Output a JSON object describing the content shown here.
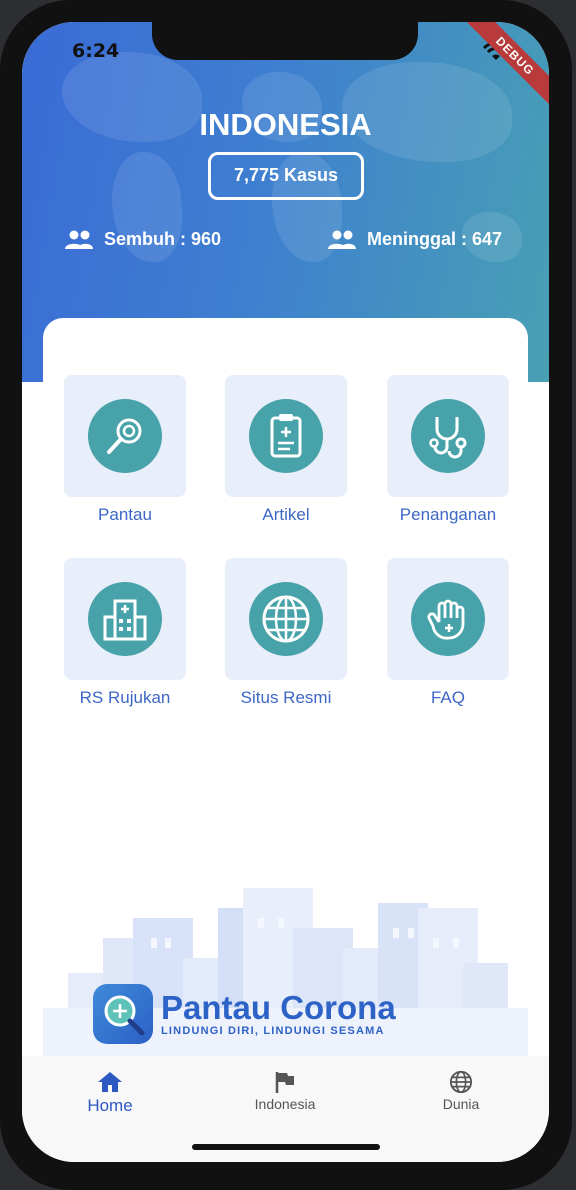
{
  "status_bar": {
    "time": "6:24",
    "debug_label": "DEBUG"
  },
  "header": {
    "country": "INDONESIA",
    "cases_label": "7,775 Kasus",
    "recovered_label": "Sembuh : 960",
    "deaths_label": "Meninggal : 647"
  },
  "menu": {
    "items": [
      {
        "label": "Pantau",
        "icon": "magnifier-icon"
      },
      {
        "label": "Artikel",
        "icon": "clipboard-icon"
      },
      {
        "label": "Penanganan",
        "icon": "stethoscope-icon"
      },
      {
        "label": "RS Rujukan",
        "icon": "hospital-icon"
      },
      {
        "label": "Situs Resmi",
        "icon": "globe-icon"
      },
      {
        "label": "FAQ",
        "icon": "hand-icon"
      }
    ]
  },
  "logo": {
    "title": "Pantau Corona",
    "tagline": "LINDUNGI DIRI, LINDUNGI SESAMA"
  },
  "bottom_nav": {
    "items": [
      {
        "label": "Home",
        "icon": "home-icon",
        "active": true
      },
      {
        "label": "Indonesia",
        "icon": "flag-icon",
        "active": false
      },
      {
        "label": "Dunia",
        "icon": "globe-icon",
        "active": false
      }
    ]
  },
  "colors": {
    "accent": "#3d67c6",
    "teal": "#47a3a9",
    "tile": "#e9eefb"
  }
}
